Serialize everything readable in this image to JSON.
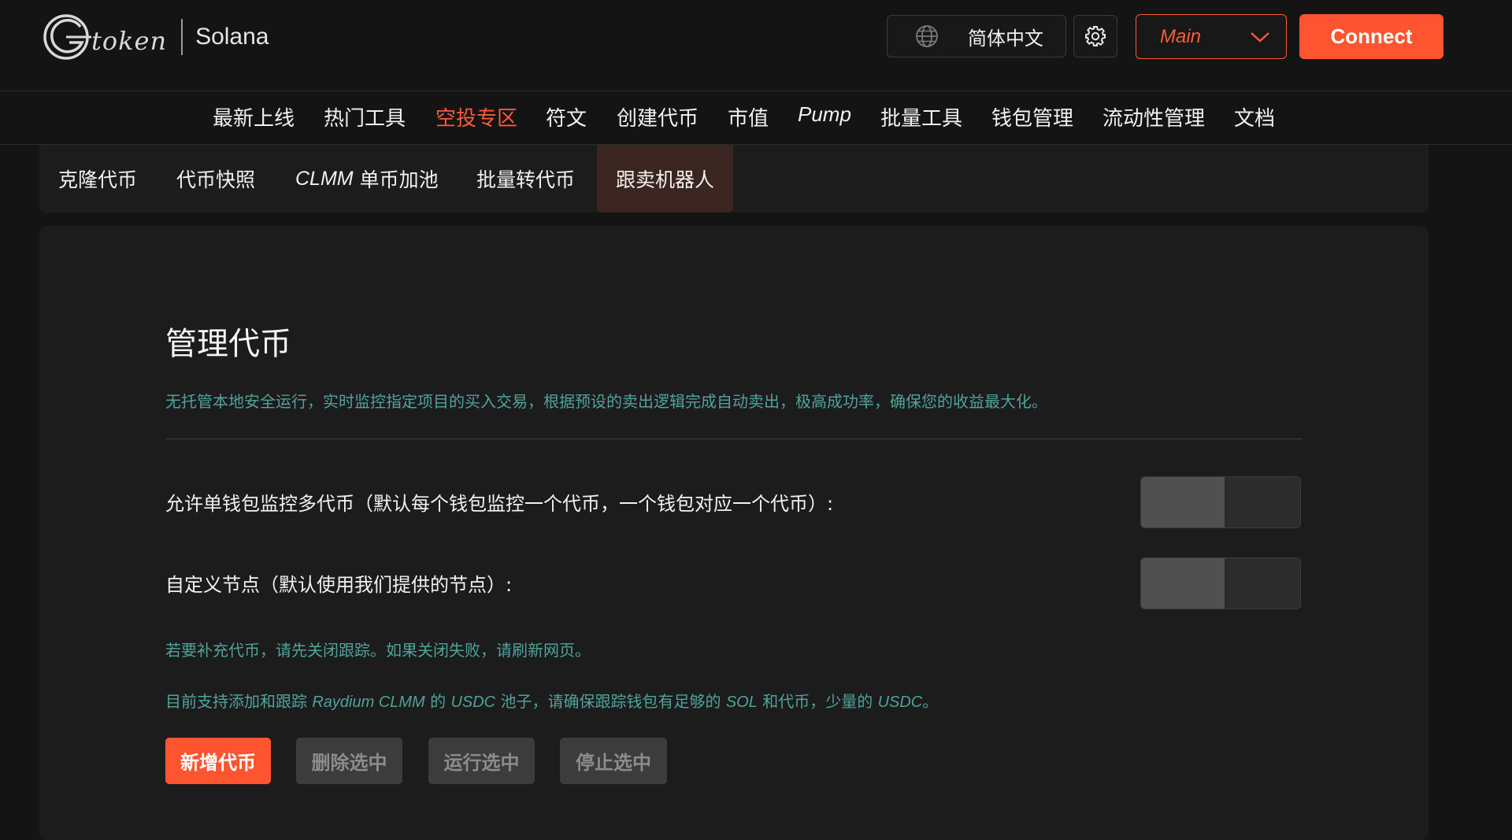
{
  "header": {
    "logo_word": "token",
    "chain": "Solana",
    "language": "简体中文",
    "network": "Main",
    "connect_label": "Connect",
    "accent_color": "#ff5430",
    "icons": [
      "logo-g-icon",
      "globe-icon",
      "gear-icon",
      "chevron-down-icon"
    ]
  },
  "main_nav": [
    {
      "label": "最新上线"
    },
    {
      "label": "热门工具"
    },
    {
      "label": "空投专区",
      "active": true
    },
    {
      "label": "符文"
    },
    {
      "label": "创建代币"
    },
    {
      "label": "市值"
    },
    {
      "label": "Pump"
    },
    {
      "label": "批量工具"
    },
    {
      "label": "钱包管理"
    },
    {
      "label": "流动性管理"
    },
    {
      "label": "文档"
    }
  ],
  "sub_nav": {
    "clone": "克隆代币",
    "snapshot": "代币快照",
    "clmm_prefix": "CLMM",
    "clmm_suffix": "单币加池",
    "batch_transfer": "批量转代币",
    "sell_bot": "跟卖机器人",
    "active": "跟卖机器人"
  },
  "main": {
    "title": "管理代币",
    "description": "无托管本地安全运行，实时监控指定项目的买入交易，根据预设的卖出逻辑完成自动卖出，极高成功率，确保您的收益最大化。",
    "options": {
      "multi_token": {
        "label": "允许单钱包监控多代币（默认每个钱包监控一个代币，一个钱包对应一个代币）:",
        "enabled": false
      },
      "custom_node": {
        "label": "自定义节点（默认使用我们提供的节点）:",
        "enabled": false
      }
    },
    "note1": "若要补充代币，请先关闭跟踪。如果关闭失败，请刷新网页。",
    "note2": {
      "p1": "目前支持添加和跟踪 ",
      "raydium": "Raydium CLMM",
      "p2": " 的 ",
      "usdc1": "USDC",
      "p3": " 池子，请确保跟踪钱包有足够的 ",
      "sol": "SOL",
      "p4": " 和代币，少量的 ",
      "usdc2": "USDC",
      "p5": "。"
    },
    "buttons": {
      "add": "新增代币",
      "delete": "删除选中",
      "run": "运行选中",
      "stop": "停止选中"
    },
    "note_color": "#4fa39a"
  }
}
